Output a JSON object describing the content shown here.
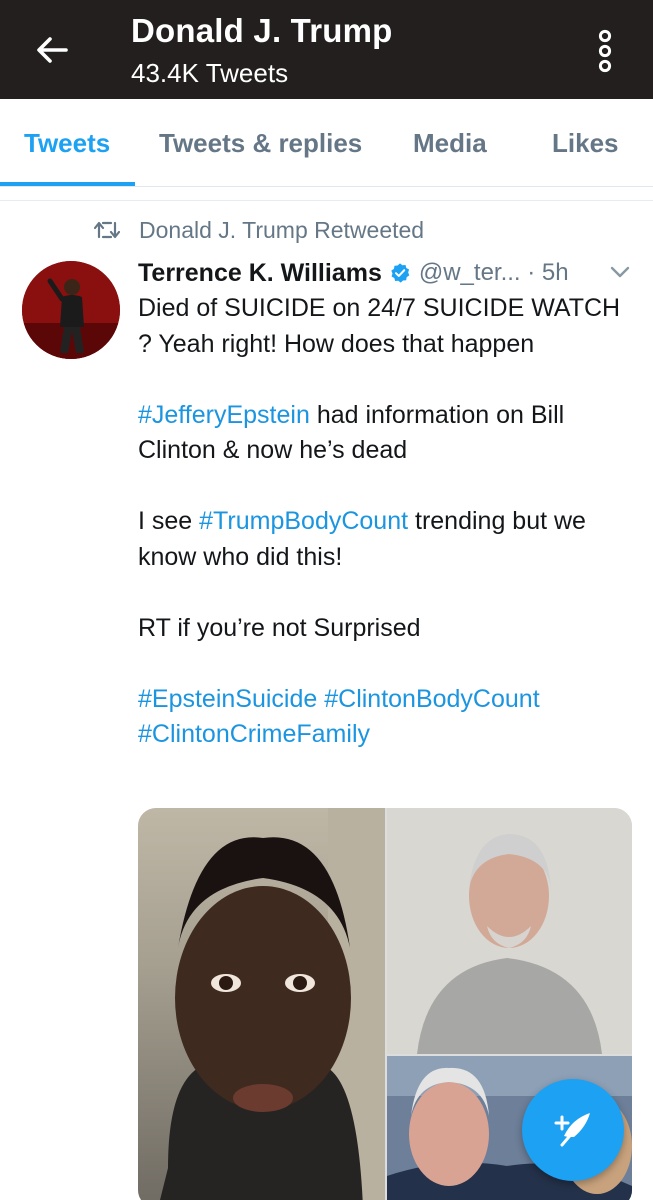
{
  "header": {
    "title": "Donald J. Trump",
    "subtitle": "43.4K Tweets",
    "back_icon": "arrow-left-icon",
    "more_icon": "more-vertical-icon"
  },
  "tabs": [
    {
      "label": "Tweets",
      "active": true
    },
    {
      "label": "Tweets & replies",
      "active": false
    },
    {
      "label": "Media",
      "active": false
    },
    {
      "label": "Likes",
      "active": false
    }
  ],
  "tweet": {
    "retweet_note": "Donald J. Trump Retweeted",
    "author_name": "Terrence K. Williams",
    "verified": true,
    "handle_time": "@w_ter... · 5h",
    "text_line1": "Died of SUICIDE on 24/7 SUICIDE WATCH ? Yeah right! How does that happen",
    "p2_hashtag": "#JefferyEpstein",
    "p2_rest": " had information on Bill Clinton & now he’s dead",
    "p3_start": "I see ",
    "p3_hashtag": "#TrumpBodyCount",
    "p3_rest": " trending but we know who did this!",
    "p4": "RT if you’re not Surprised",
    "tags_line1": "#EpsteinSuicide #ClintonBodyCount",
    "tags_line2": "#ClintonCrimeFamily"
  },
  "colors": {
    "accent": "#1da1f2",
    "hashtag": "#1b95e0",
    "header_bg": "#231f1e",
    "muted": "#657786"
  },
  "fab": {
    "icon": "compose-tweet-icon"
  }
}
